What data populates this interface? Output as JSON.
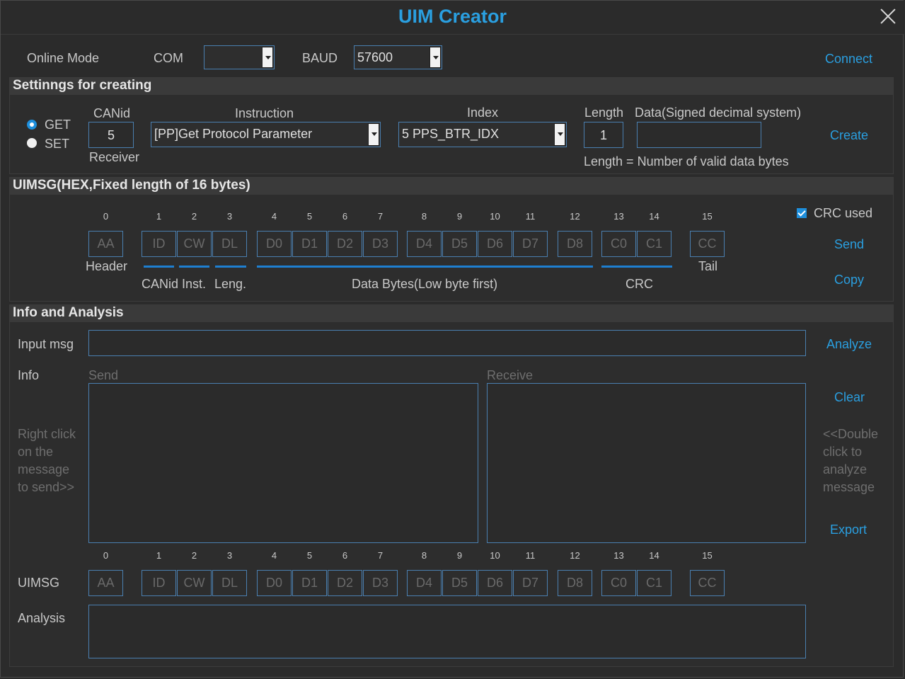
{
  "window": {
    "title": "UIM Creator"
  },
  "online": {
    "mode_label": "Online Mode",
    "com_label": "COM",
    "com_value": "",
    "baud_label": "BAUD",
    "baud_value": "57600",
    "connect": "Connect"
  },
  "settings": {
    "heading": "Settinngs for creating",
    "get": "GET",
    "set": "SET",
    "canid_label": "CANid",
    "canid_value": "5",
    "receiver_label": "Receiver",
    "instruction_label": "Instruction",
    "instruction_value": "[PP]Get Protocol Parameter",
    "index_label": "Index",
    "index_value": "5 PPS_BTR_IDX",
    "length_label": "Length",
    "length_value": "1",
    "data_label": "Data(Signed decimal system)",
    "data_value": "",
    "length_note": "Length = Number of valid data bytes",
    "create": "Create"
  },
  "uimsg": {
    "heading": "UIMSG(HEX,Fixed length of 16 bytes)",
    "indices": [
      "0",
      "1",
      "2",
      "3",
      "4",
      "5",
      "6",
      "7",
      "8",
      "9",
      "10",
      "11",
      "12",
      "13",
      "14",
      "15"
    ],
    "bytes": [
      "AA",
      "ID",
      "CW",
      "DL",
      "D0",
      "D1",
      "D2",
      "D3",
      "D4",
      "D5",
      "D6",
      "D7",
      "D8",
      "C0",
      "C1",
      "CC"
    ],
    "header_label": "Header",
    "canid_label": "CANid",
    "inst_label": "Inst.",
    "leng_label": "Leng.",
    "data_label": "Data Bytes(Low byte first)",
    "crc_label": "CRC",
    "tail_label": "Tail",
    "crc_used": "CRC used",
    "send": "Send",
    "copy": "Copy"
  },
  "info": {
    "heading": "Info and Analysis",
    "input_label": "Input msg",
    "input_value": "",
    "analyze": "Analyze",
    "info_label": "Info",
    "send_label": "Send",
    "receive_label": "Receive",
    "clear": "Clear",
    "right_hint": [
      "Right click",
      "on the",
      "message",
      "to send>>"
    ],
    "left_hint": [
      "<<Double",
      "click to",
      "analyze",
      "message"
    ],
    "export": "Export",
    "uimsg_label": "UIMSG",
    "analysis_label": "Analysis"
  },
  "colors": {
    "accent": "#2a9fe0",
    "background": "#2b2b2b",
    "border": "#4a7fb0"
  }
}
